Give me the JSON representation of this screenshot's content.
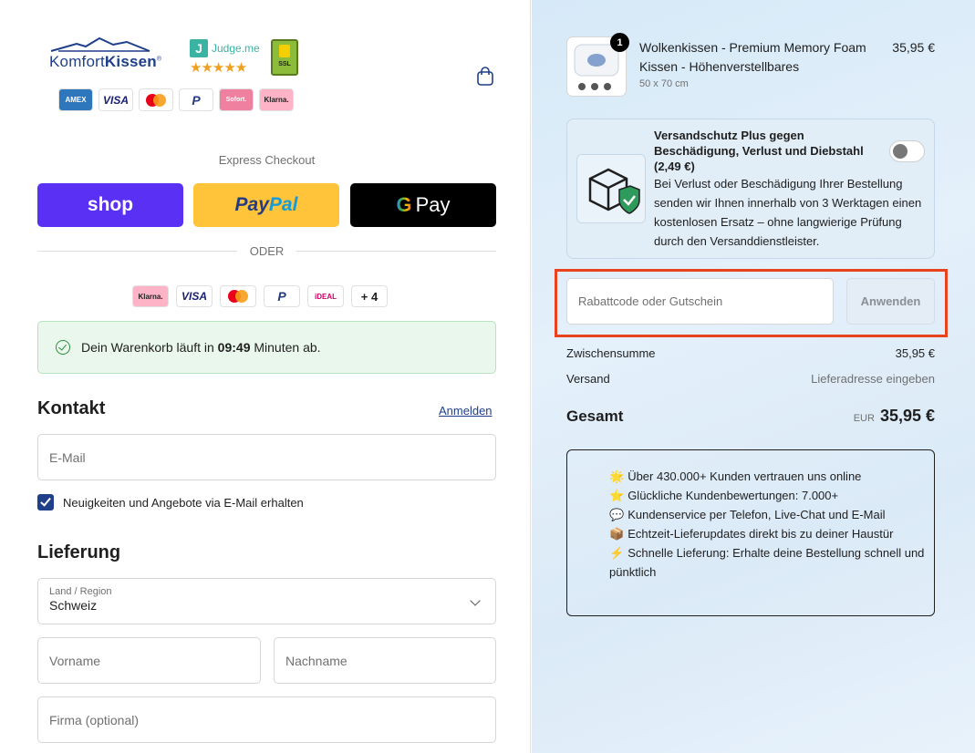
{
  "brand": {
    "name_light": "Komfort",
    "name_bold": "Kissen",
    "registered": "®"
  },
  "judgeme": {
    "letter": "J",
    "label": "Judge.me",
    "stars": "★★★★★"
  },
  "ssl": {
    "label": "SSL",
    "sub": "Secure Connection"
  },
  "payment_logos": [
    "AMEX",
    "VISA",
    "Mastercard",
    "PayPal",
    "Sofort.",
    "Klarna."
  ],
  "express": {
    "title": "Express Checkout",
    "shop_label": "shop",
    "paypal_p1": "Pay",
    "paypal_p2": "Pal",
    "gpay_g": "G",
    "gpay_label": "Pay",
    "divider": "ODER"
  },
  "alt_payments": [
    "Klarna.",
    "VISA",
    "Mastercard",
    "PayPal",
    "iDEAL",
    "+ 4"
  ],
  "timer": {
    "prefix": "Dein Warenkorb läuft in ",
    "time": "09:49",
    "suffix": " Minuten ab."
  },
  "kontakt": {
    "heading": "Kontakt",
    "login_link": "Anmelden",
    "email_placeholder": "E-Mail",
    "newsletter_label": "Neuigkeiten und Angebote via E-Mail erhalten",
    "newsletter_checked": true
  },
  "lieferung": {
    "heading": "Lieferung",
    "country_label": "Land / Region",
    "country_value": "Schweiz",
    "firstname_placeholder": "Vorname",
    "lastname_placeholder": "Nachname",
    "company_placeholder": "Firma (optional)"
  },
  "cart": {
    "product_title": "Wolkenkissen - Premium Memory Foam Kissen - Höhenverstellbares",
    "product_variant": "50 x 70 cm",
    "product_price": "35,95 €",
    "quantity": "1"
  },
  "protection": {
    "title": "Versandschutz Plus gegen Beschädigung, Verlust und Diebstahl (2,49 €)",
    "description": "Bei Verlust oder Beschädigung Ihrer Bestellung senden wir Ihnen innerhalb von 3 Werktagen einen kostenlosen Ersatz – ohne langwierige Prüfung durch den Versanddienstleister.",
    "enabled": false
  },
  "discount": {
    "placeholder": "Rabattcode oder Gutschein",
    "apply_label": "Anwenden"
  },
  "summary": {
    "subtotal_label": "Zwischensumme",
    "subtotal_value": "35,95 €",
    "shipping_label": "Versand",
    "shipping_value": "Lieferadresse eingeben",
    "total_label": "Gesamt",
    "total_currency": "EUR",
    "total_value": "35,95 €"
  },
  "trust": [
    {
      "icon": "star-icon",
      "emoji": "🌟",
      "text": "Über 430.000+ Kunden vertrauen uns online"
    },
    {
      "icon": "star-icon",
      "emoji": "⭐",
      "text": "Glückliche Kundenbewertungen: 7.000+"
    },
    {
      "icon": "speech-bubble-icon",
      "emoji": "💬",
      "text": "Kundenservice per Telefon, Live-Chat und E-Mail"
    },
    {
      "icon": "package-icon",
      "emoji": "📦",
      "text": "Echtzeit-Lieferupdates direkt bis zu deiner Haustür"
    },
    {
      "icon": "lightning-icon",
      "emoji": "⚡",
      "text": "Schnelle Lieferung: Erhalte deine Bestellung schnell und pünktlich"
    }
  ],
  "colors": {
    "brand_blue": "#1f3f8a",
    "shop_purple": "#5a31f4",
    "paypal_yellow": "#ffc439",
    "highlight_red": "#e8431c",
    "success_green": "#2e8b3e"
  }
}
